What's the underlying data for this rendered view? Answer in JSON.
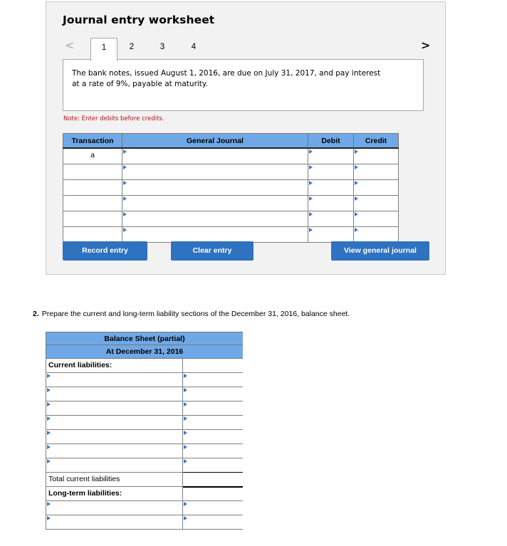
{
  "worksheet": {
    "title": "Journal entry worksheet",
    "nav_prev_icon": "chevron-left-icon",
    "nav_next_icon": "chevron-right-icon",
    "tabs": [
      {
        "label": "1",
        "active": true
      },
      {
        "label": "2",
        "active": false
      },
      {
        "label": "3",
        "active": false
      },
      {
        "label": "4",
        "active": false
      }
    ],
    "description": "The bank notes, issued August 1, 2016, are due on July 31, 2017, and pay interest at a rate of 9%, payable at maturity.",
    "note": "Note: Enter debits before credits.",
    "table": {
      "headers": {
        "transaction": "Transaction",
        "general_journal": "General Journal",
        "debit": "Debit",
        "credit": "Credit"
      },
      "rows": [
        {
          "transaction": "a",
          "account": "",
          "debit": "",
          "credit": ""
        },
        {
          "transaction": "",
          "account": "",
          "debit": "",
          "credit": ""
        },
        {
          "transaction": "",
          "account": "",
          "debit": "",
          "credit": ""
        },
        {
          "transaction": "",
          "account": "",
          "debit": "",
          "credit": ""
        },
        {
          "transaction": "",
          "account": "",
          "debit": "",
          "credit": ""
        },
        {
          "transaction": "",
          "account": "",
          "debit": "",
          "credit": ""
        }
      ]
    },
    "buttons": {
      "record": "Record entry",
      "clear": "Clear entry",
      "view": "View general journal"
    }
  },
  "question": {
    "number": "2.",
    "text": "Prepare the current and long-term liability sections of the December 31, 2016, balance sheet."
  },
  "balance_sheet": {
    "title": "Balance Sheet (partial)",
    "date": "At December 31, 2016",
    "current_label": "Current liabilities:",
    "current_rows": 7,
    "total_current_label": "Total current liabilities",
    "long_term_label": "Long-term liabilities:",
    "long_term_rows": 2
  },
  "colors": {
    "header_blue": "#6fa8e6",
    "button_blue": "#2f72c0",
    "note_red": "#b0121b",
    "marker_blue": "#3a78c8"
  }
}
